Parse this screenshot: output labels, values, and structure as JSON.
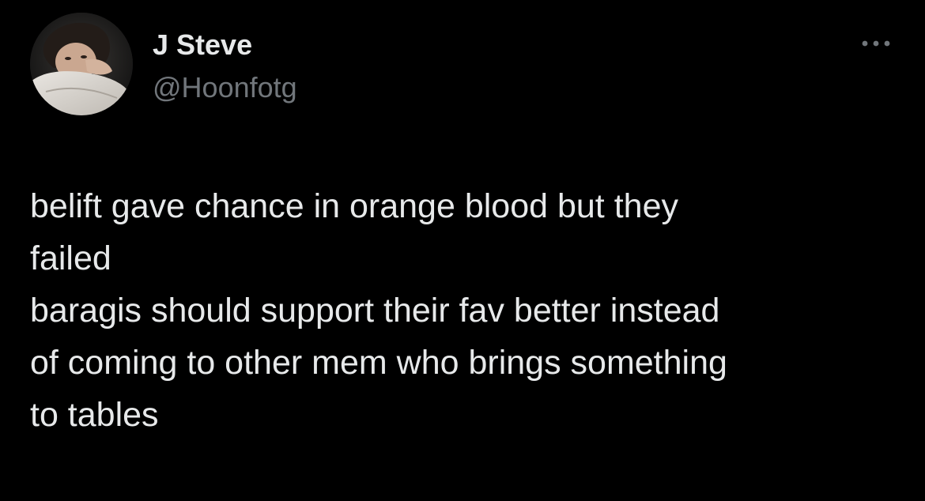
{
  "tweet": {
    "author": {
      "display_name": "J Steve",
      "handle": "@Hoonfotg",
      "avatar_icon": "profile-photo"
    },
    "more_icon": "more-options-icon",
    "text_lines": [
      "belift gave chance in orange blood but they",
      "failed",
      "baragis should support their fav better instead",
      "of coming to other mem who brings something",
      "to tables"
    ]
  },
  "colors": {
    "background": "#000000",
    "primary_text": "#e7e9ea",
    "secondary_text": "#71767b"
  }
}
